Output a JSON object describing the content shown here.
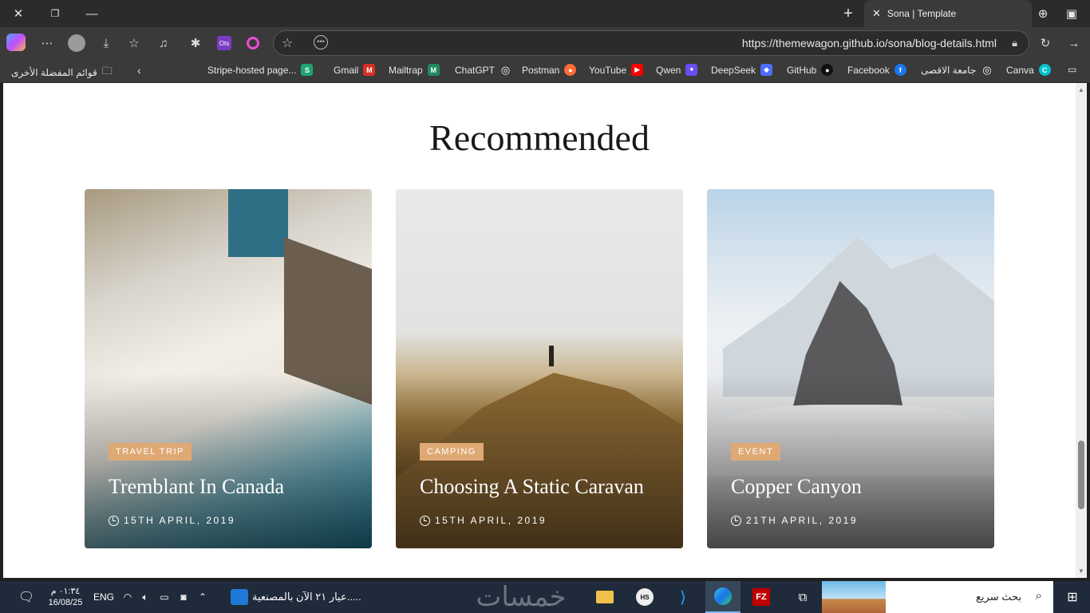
{
  "browser": {
    "tab_title": "Sona | Template",
    "url": "https://themewagon.github.io/sona/blog-details.html",
    "new_tab_symbol": "+",
    "close_symbol": "✕"
  },
  "bookmarks": {
    "other_favorites": "قوائم المفضلة الأخرى",
    "items": [
      {
        "label": "Stripe-hosted page...",
        "icon": "S"
      },
      {
        "label": "Gmail",
        "icon": "M"
      },
      {
        "label": "Mailtrap",
        "icon": "M"
      },
      {
        "label": "ChatGPT",
        "icon": "◎"
      },
      {
        "label": "Postman",
        "icon": "●"
      },
      {
        "label": "YouTube",
        "icon": "▶"
      },
      {
        "label": "Qwen",
        "icon": "✦"
      },
      {
        "label": "DeepSeek",
        "icon": "◆"
      },
      {
        "label": "GitHub",
        "icon": "●"
      },
      {
        "label": "Facebook",
        "icon": "f"
      },
      {
        "label": "جامعة الاقصى",
        "icon": "◎"
      },
      {
        "label": "Canva",
        "icon": "C"
      }
    ]
  },
  "page": {
    "heading": "Recommended",
    "cards": [
      {
        "tag": "Travel Trip",
        "title": "Tremblant In Canada",
        "date": "15TH APRIL, 2019"
      },
      {
        "tag": "Camping",
        "title": "Choosing A Static Caravan",
        "date": "15TH APRIL, 2019"
      },
      {
        "tag": "Event",
        "title": "Copper Canyon",
        "date": "21TH APRIL, 2019"
      }
    ]
  },
  "taskbar": {
    "time": "٠١:٣٤ م",
    "date": "16/08/25",
    "lang": "ENG",
    "news": "عيار ٢١ الآن بالمصنعية.....",
    "search_placeholder": "بحث سريع",
    "watermark": "خمسات"
  },
  "colors": {
    "accent": "#dfa974",
    "heading": "#19191a"
  }
}
